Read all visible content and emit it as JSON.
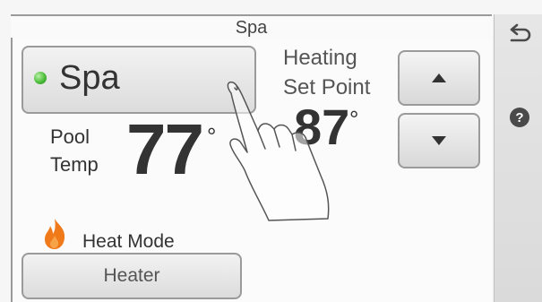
{
  "header": {
    "title": "Spa"
  },
  "mode_button": {
    "label": "Spa",
    "led_color": "#4cbd3b"
  },
  "pool_temp": {
    "label_line1": "Pool",
    "label_line2": "Temp",
    "value": "77",
    "unit": "°"
  },
  "set_point": {
    "label_line1": "Heating",
    "label_line2": "Set Point",
    "value": "87",
    "unit": "°"
  },
  "arrows": {
    "up_icon": "triangle-up-icon",
    "down_icon": "triangle-down-icon"
  },
  "heat_mode": {
    "label": "Heat Mode",
    "button_label": "Heater",
    "flame_color": "#f07a1a"
  },
  "side_panel": {
    "back_icon": "back-arrow-icon",
    "help_label": "?"
  }
}
